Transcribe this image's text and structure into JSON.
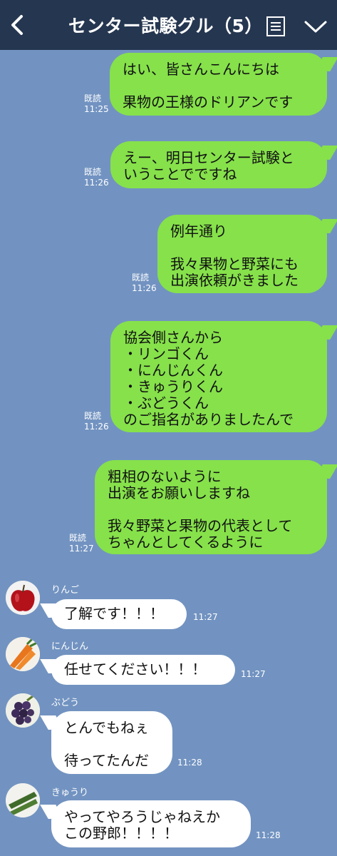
{
  "header": {
    "title": "センター試験グル（5）",
    "back_icon": "chevron-left-icon",
    "menu_icon": "notes-icon",
    "expand_icon": "chevron-down-icon",
    "colors": {
      "bar": "#253650",
      "background": "#7293c1",
      "sent_bubble": "#86e14b",
      "received_bubble": "#ffffff"
    }
  },
  "sent": [
    {
      "lines": [
        "はい、皆さんこんにちは",
        "",
        "果物の王様のドリアンです"
      ],
      "read": "既読",
      "time": "11:25"
    },
    {
      "lines": [
        "えー、明日センター試験と",
        "いうことでですね"
      ],
      "read": "既読",
      "time": "11:26"
    },
    {
      "lines": [
        "例年通り",
        "",
        "我々果物と野菜にも",
        "出演依頼がきました"
      ],
      "read": "既読",
      "time": "11:26"
    },
    {
      "lines": [
        "協会側さんから",
        "・リンゴくん",
        "・にんじんくん",
        "・きゅうりくん",
        "・ぶどうくん",
        "のご指名がありましたんで"
      ],
      "read": "既読",
      "time": "11:26"
    },
    {
      "lines": [
        "粗相のないように",
        "出演をお願いしますね",
        "",
        "我々野菜と果物の代表として",
        "ちゃんとしてくるように"
      ],
      "read": "既読",
      "time": "11:27"
    }
  ],
  "received": [
    {
      "sender": "りんご",
      "avatar": "apple-avatar",
      "lines": [
        "了解です！！！"
      ],
      "time": "11:27"
    },
    {
      "sender": "にんじん",
      "avatar": "carrot-avatar",
      "lines": [
        "任せてください！！！"
      ],
      "time": "11:27"
    },
    {
      "sender": "ぶどう",
      "avatar": "grapes-avatar",
      "lines": [
        "とんでもねぇ",
        "",
        "待ってたんだ"
      ],
      "time": "11:28"
    },
    {
      "sender": "きゅうり",
      "avatar": "cucumber-avatar",
      "lines": [
        "やってやろうじゃねえか",
        "この野郎！！！！"
      ],
      "time": "11:28"
    }
  ]
}
